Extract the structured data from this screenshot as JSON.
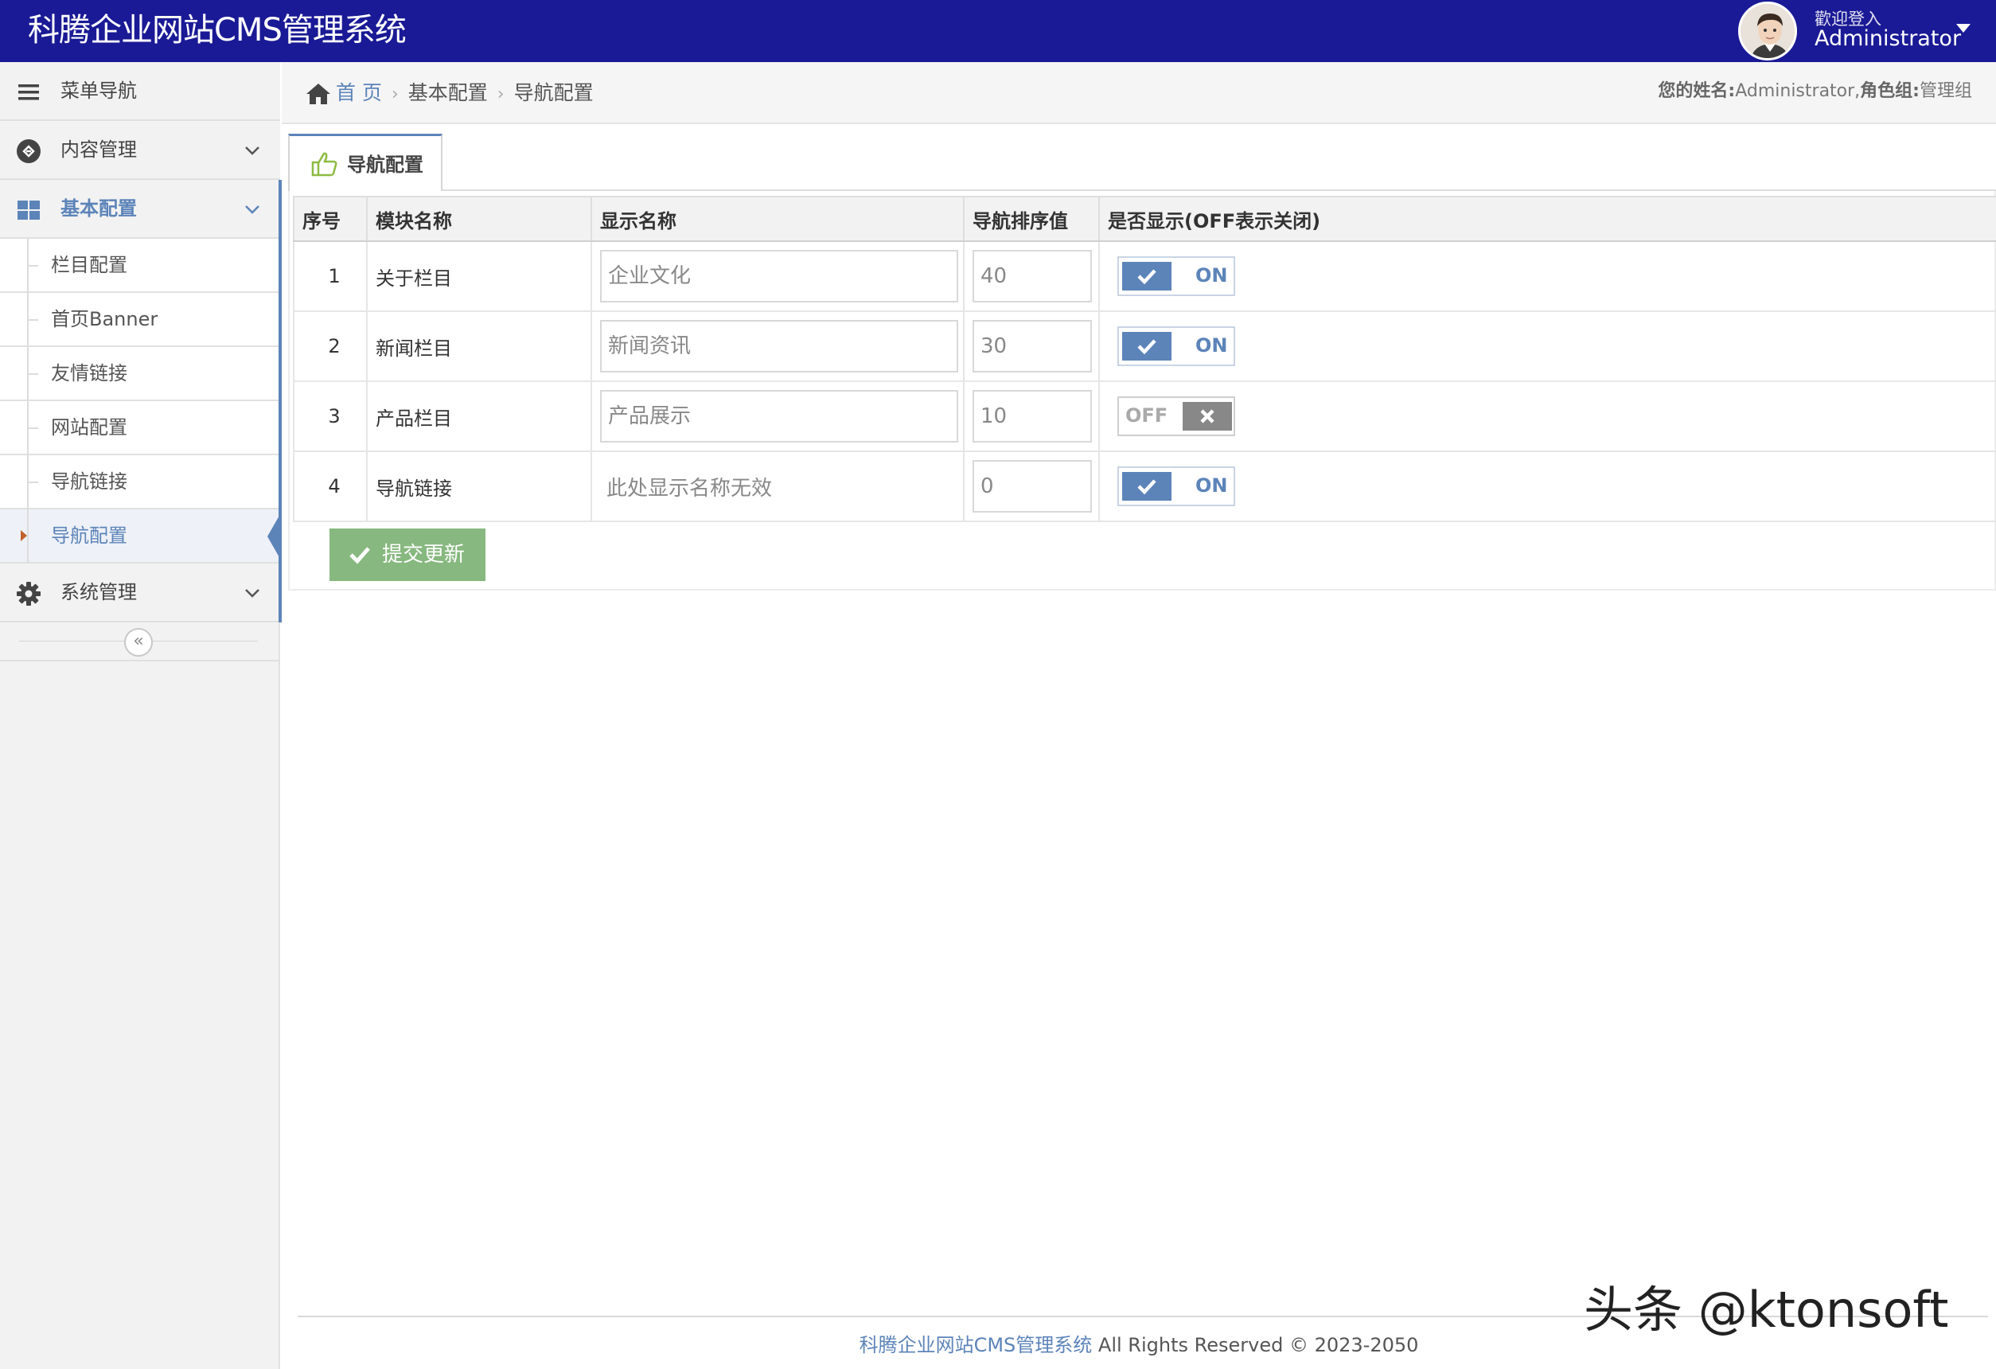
{
  "header": {
    "app_title": "科腾企业网站CMS管理系统",
    "welcome_text": "歡迎登入",
    "username": "Administrator",
    "avatar_icon": "user-avatar"
  },
  "sidebar": {
    "menu_nav_label": "菜单导航",
    "groups": [
      {
        "label": "内容管理",
        "icon": "content-icon",
        "expanded": false
      },
      {
        "label": "基本配置",
        "icon": "dashboard-grid-icon",
        "expanded": true,
        "items": [
          "栏目配置",
          "首页Banner",
          "友情链接",
          "网站配置",
          "导航链接",
          "导航配置"
        ],
        "active_item": "导航配置"
      },
      {
        "label": "系统管理",
        "icon": "gear-icon",
        "expanded": false
      }
    ],
    "collapse_symbol": "«"
  },
  "breadcrumb": {
    "home": "首 页",
    "level1": "基本配置",
    "level2": "导航配置",
    "sep": "›"
  },
  "user_info": {
    "name_label": "您的姓名:",
    "name_value": "Administrator,",
    "role_label": "角色组:",
    "role_value": "管理组"
  },
  "tab": {
    "label": "导航配置",
    "icon": "thumbs-up-icon"
  },
  "table": {
    "headers": [
      "序号",
      "模块名称",
      "显示名称",
      "导航排序值",
      "是否显示(OFF表示关闭)"
    ],
    "rows": [
      {
        "index": "1",
        "module": "关于栏目",
        "display_name": "企业文化",
        "editable": true,
        "sort": "40",
        "toggle": "ON"
      },
      {
        "index": "2",
        "module": "新闻栏目",
        "display_name": "新闻资讯",
        "editable": true,
        "sort": "30",
        "toggle": "ON"
      },
      {
        "index": "3",
        "module": "产品栏目",
        "display_name": "产品展示",
        "editable": true,
        "sort": "10",
        "toggle": "OFF"
      },
      {
        "index": "4",
        "module": "导航链接",
        "display_name": "此处显示名称无效",
        "editable": false,
        "sort": "0",
        "toggle": "ON"
      }
    ]
  },
  "submit_label": "提交更新",
  "footer": {
    "name": "科腾企业网站CMS管理系统",
    "rights": "All Rights Reserved © 2023-2050"
  },
  "watermark": "头条 @ktonsoft",
  "colors": {
    "header_bg": "#1a1a96",
    "accent": "#5c84b9",
    "submit_green": "#87b87f"
  }
}
